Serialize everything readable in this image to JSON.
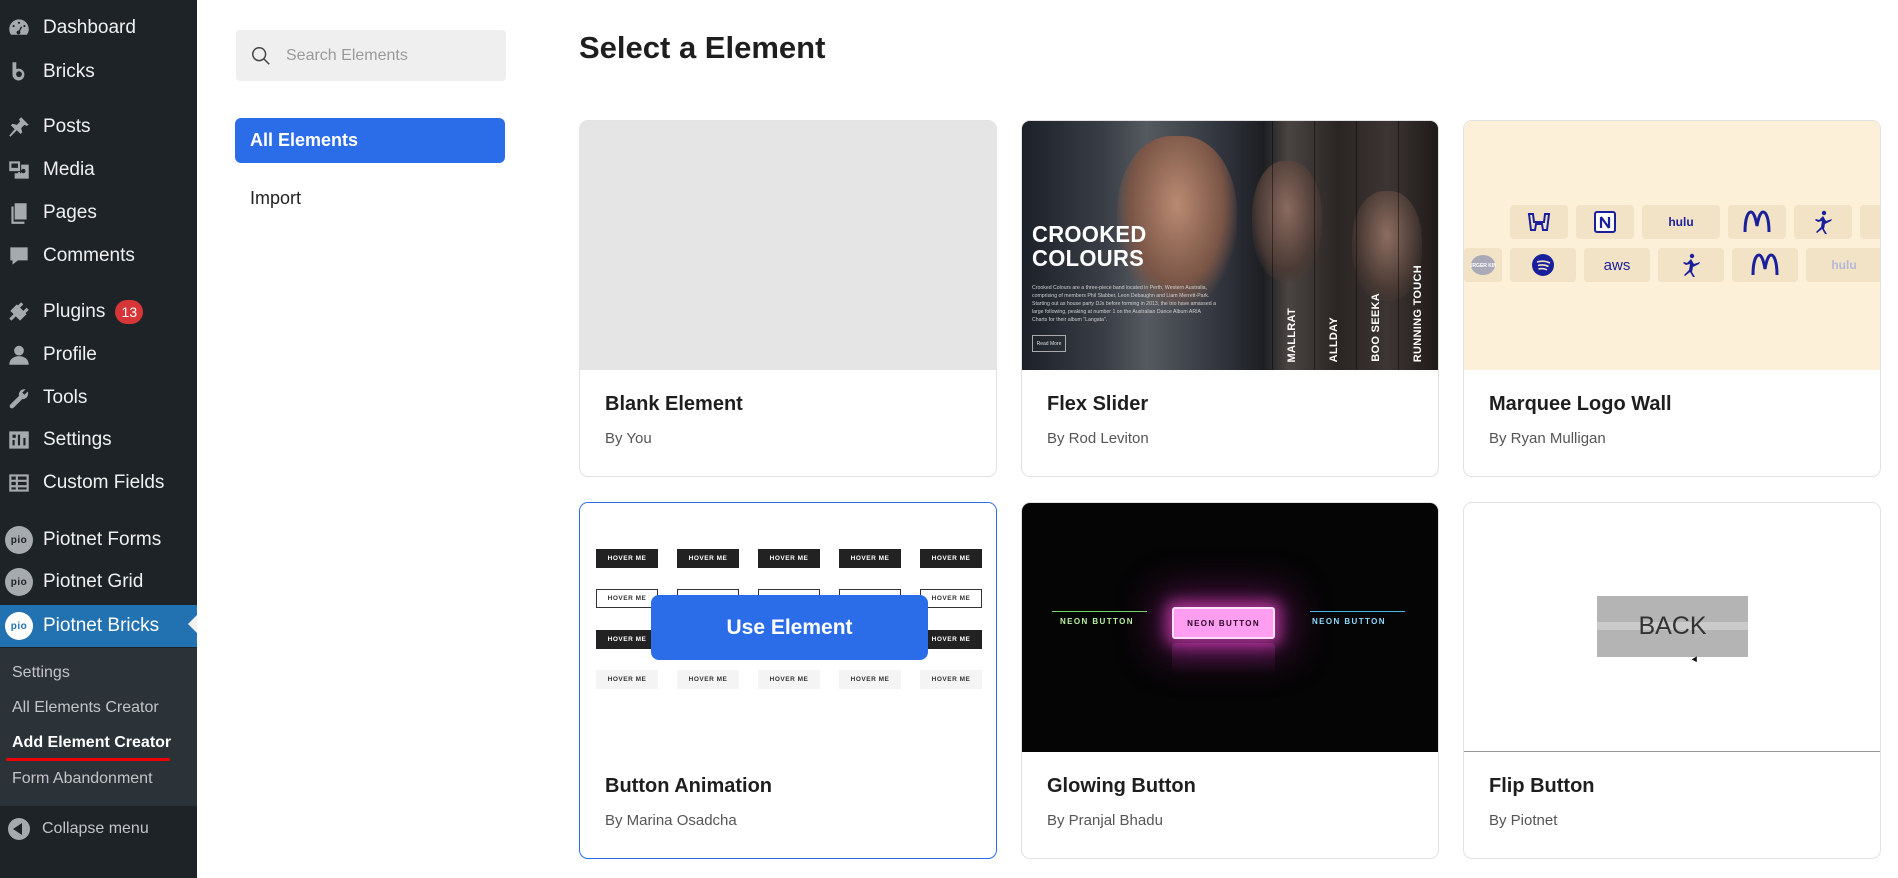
{
  "sidebar": {
    "items": [
      {
        "label": "Dashboard",
        "icon": "dashboard-icon"
      },
      {
        "label": "Bricks",
        "icon": "bricks-icon"
      },
      {
        "label": "Posts",
        "icon": "pin-icon"
      },
      {
        "label": "Media",
        "icon": "media-icon"
      },
      {
        "label": "Pages",
        "icon": "pages-icon"
      },
      {
        "label": "Comments",
        "icon": "comment-icon"
      },
      {
        "label": "Plugins",
        "icon": "plugin-icon",
        "badge": "13"
      },
      {
        "label": "Profile",
        "icon": "user-icon"
      },
      {
        "label": "Tools",
        "icon": "wrench-icon"
      },
      {
        "label": "Settings",
        "icon": "settings-icon"
      },
      {
        "label": "Custom Fields",
        "icon": "table-icon"
      },
      {
        "label": "Piotnet Forms",
        "icon": "pio-icon",
        "icon_text": "pio"
      },
      {
        "label": "Piotnet Grid",
        "icon": "pio-icon",
        "icon_text": "pio"
      },
      {
        "label": "Piotnet Bricks",
        "icon": "pio-icon",
        "icon_text": "pio"
      }
    ],
    "submenu": [
      "Settings",
      "All Elements Creator",
      "Add Element Creator",
      "Form Abandonment"
    ],
    "collapse_label": "Collapse menu"
  },
  "left_panel": {
    "search_placeholder": "Search Elements",
    "filters": [
      "All Elements",
      "Import"
    ]
  },
  "main": {
    "title": "Select a Element",
    "use_button": "Use Element",
    "cards": [
      {
        "name": "Blank Element",
        "author": "By You"
      },
      {
        "name": "Flex Slider",
        "author": "By Rod Leviton"
      },
      {
        "name": "Marquee Logo Wall",
        "author": "By Ryan Mulligan"
      },
      {
        "name": "Button Animation",
        "author": "By Marina Osadcha"
      },
      {
        "name": "Glowing Button",
        "author": "By Pranjal Bhadu"
      },
      {
        "name": "Flip Button",
        "author": "By Piotnet"
      }
    ],
    "flex_preview": {
      "title_line1": "CROOKED",
      "title_line2": "COLOURS",
      "body": "Crooked Colours are a three-piece band located in Perth, Western Australia, comprising of members Phil Slabber, Leon Debaughn and Liam Merrett-Park. Starting out as house party DJs before forming in 2013, the trio have amassed a large following, peaking at number 1 on the Australian Dance Album ARIA Charts for their album \"Langata\".",
      "button": "Read More",
      "vertical_labels": [
        "MALLRAT",
        "ALLDAY",
        "BOO SEEKA",
        "RUNNING TOUCH"
      ]
    },
    "marquee_preview": {
      "row1": [
        "honda-logo",
        "notion-logo",
        "hulu",
        "mcdonalds-logo",
        "jordan-logo"
      ],
      "row2": [
        "burger-king-logo",
        "spotify-logo",
        "aws",
        "jordan-logo",
        "mcdonalds-logo",
        "hulu"
      ]
    },
    "button_anim_preview": {
      "label": "HOVER ME"
    },
    "glow_preview": {
      "label": "NEON BUTTON"
    },
    "flip_preview": {
      "label": "BACK"
    }
  }
}
